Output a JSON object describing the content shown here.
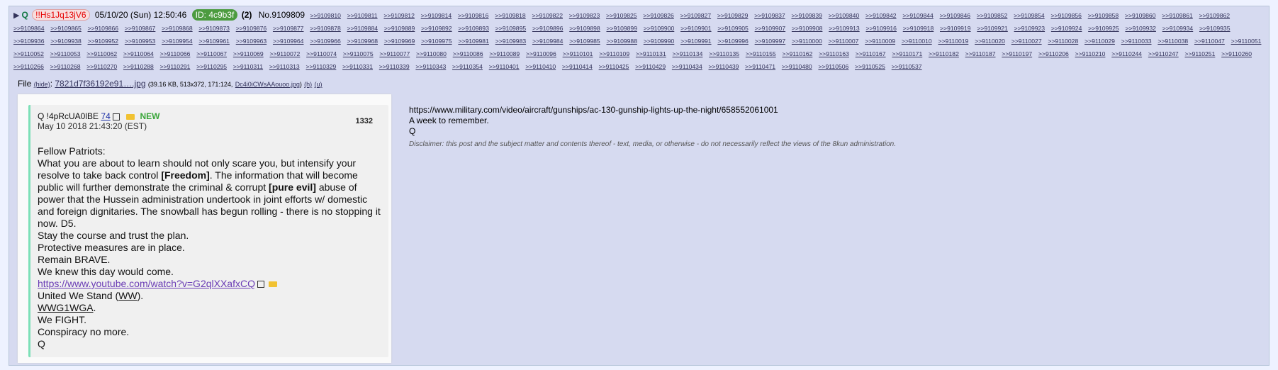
{
  "post": {
    "name": "Q",
    "tripcode": "!!Hs1Jq13jV6",
    "datetime": "05/10/20 (Sun) 12:50:46",
    "poster_id": "ID: 4c9b3f",
    "post_count": "(2)",
    "post_no": "No.9109809",
    "backlinks": [
      ">>9109810",
      ">>9109811",
      ">>9109812",
      ">>9109814",
      ">>9109816",
      ">>9109818",
      ">>9109822",
      ">>9109823",
      ">>9109825",
      ">>9109826",
      ">>9109827",
      ">>9109829",
      ">>9109837",
      ">>9109839",
      ">>9109840",
      ">>9109842",
      ">>9109844",
      ">>9109846",
      ">>9109852",
      ">>9109854",
      ">>9109856",
      ">>9109858",
      ">>9109860",
      ">>9109861",
      ">>9109862",
      ">>9109864",
      ">>9109865",
      ">>9109866",
      ">>9109867",
      ">>9109868",
      ">>9109873",
      ">>9109876",
      ">>9109877",
      ">>9109878",
      ">>9109884",
      ">>9109889",
      ">>9109892",
      ">>9109893",
      ">>9109895",
      ">>9109896",
      ">>9109898",
      ">>9109899",
      ">>9109900",
      ">>9109901",
      ">>9109905",
      ">>9109907",
      ">>9109908",
      ">>9109913",
      ">>9109916",
      ">>9109918",
      ">>9109919",
      ">>9109921",
      ">>9109923",
      ">>9109924",
      ">>9109925",
      ">>9109932",
      ">>9109934",
      ">>9109935",
      ">>9109936",
      ">>9109938",
      ">>9109952",
      ">>9109953",
      ">>9109954",
      ">>9109961",
      ">>9109963",
      ">>9109964",
      ">>9109966",
      ">>9109968",
      ">>9109969",
      ">>9109975",
      ">>9109981",
      ">>9109983",
      ">>9109984",
      ">>9109985",
      ">>9109988",
      ">>9109990",
      ">>9109991",
      ">>9109996",
      ">>9109997",
      ">>9110000",
      ">>9110007",
      ">>9110009",
      ">>9110010",
      ">>9110019",
      ">>9110020",
      ">>9110027",
      ">>9110028",
      ">>9110029",
      ">>9110033",
      ">>9110038",
      ">>9110047",
      ">>9110051",
      ">>9110052",
      ">>9110053",
      ">>9110062",
      ">>9110064",
      ">>9110066",
      ">>9110067",
      ">>9110069",
      ">>9110072",
      ">>9110074",
      ">>9110075",
      ">>9110077",
      ">>9110080",
      ">>9110086",
      ">>9110089",
      ">>9110096",
      ">>9110101",
      ">>9110109",
      ">>9110131",
      ">>9110134",
      ">>9110135",
      ">>9110155",
      ">>9110162",
      ">>9110163",
      ">>9110167",
      ">>9110171",
      ">>9110182",
      ">>9110187",
      ">>9110197",
      ">>9110206",
      ">>9110210",
      ">>9110244",
      ">>9110247",
      ">>9110251",
      ">>9110260",
      ">>9110266",
      ">>9110268",
      ">>9110270",
      ">>9110288",
      ">>9110291",
      ">>9110295",
      ">>9110311",
      ">>9110313",
      ">>9110329",
      ">>9110331",
      ">>9110339",
      ">>9110343",
      ">>9110354",
      ">>9110401",
      ">>9110410",
      ">>9110414",
      ">>9110425",
      ">>9110429",
      ">>9110434",
      ">>9110439",
      ">>9110471",
      ">>9110480",
      ">>9110506",
      ">>9110525",
      ">>9110537"
    ]
  },
  "file": {
    "label": "File",
    "hide": "(hide)",
    "name": "7821d7f36192e91….jpg",
    "meta": "(39.16 KB, 513x372, 171:124,",
    "orig": "Dc4i0iCWsAAouoo.jpg",
    "tail": ")",
    "h": "(h)",
    "u": "(u)"
  },
  "card": {
    "head": "Q !4pRcUA0lBE",
    "ref": "74",
    "new": "NEW",
    "ts": "May 10 2018 21:43:20 (EST)",
    "num": "1332",
    "l1": "Fellow Patriots:",
    "l2a": "What you are about to learn should not only scare you, but intensify your resolve to take back control ",
    "l2b": "[Freedom]",
    "l2c": ". The information that will become public will further demonstrate the criminal & corrupt ",
    "l2d": "[pure evil]",
    "l2e": " abuse of power that the Hussein administration undertook in joint efforts w/ domestic and foreign dignitaries. The snowball has begun rolling - there is no stopping it now. D5.",
    "l3": "Stay the course and trust the plan.",
    "l4": "Protective measures are in place.",
    "l5": "Remain BRAVE.",
    "l6": "We knew this day would come.",
    "link": "https://www.youtube.com/watch?v=G2qlXXafxCQ",
    "l7a": "United We Stand (",
    "l7b": "WW",
    "l7c": ").",
    "l8a": "WWG1WGA",
    "l8b": ".",
    "l9": "We FIGHT.",
    "l10": "Conspiracy no more.",
    "l11": "Q"
  },
  "message": {
    "url": "https://www.military.com/video/aircraft/gunships/ac-130-gunship-lights-up-the-night/658552061001",
    "line2": "A week to remember.",
    "line3": "Q",
    "disclaimer": "Disclaimer: this post and the subject matter and contents thereof - text, media, or otherwise - do not necessarily reflect the views of the 8kun administration."
  },
  "icons": {
    "collapse": "triangle-right-icon",
    "external": "external-link-icon",
    "folder": "folder-icon"
  },
  "colors": {
    "post_bg": "#d6daf0",
    "name": "#117743",
    "id_badge": "#4c9b3f",
    "trip": "#e60000",
    "link": "#34345c"
  }
}
